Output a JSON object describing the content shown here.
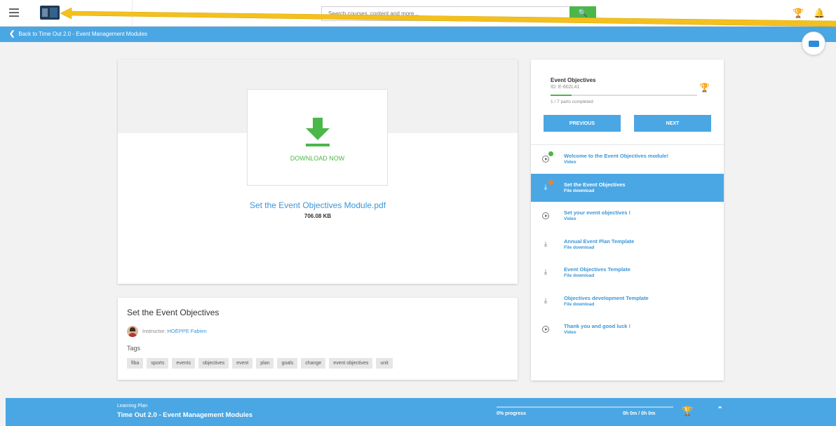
{
  "topbar": {
    "search_placeholder": "Search courses, content and more...",
    "menu_icon": "hamburger-icon",
    "search_icon": "search-icon",
    "trophy_icon": "trophy-icon",
    "bell_icon": "bell-icon"
  },
  "subbar": {
    "back_label": "Back to Time Out 2.0 - Event Management Modules"
  },
  "main": {
    "download_label": "DOWNLOAD NOW",
    "file_name": "Set the Event Objectives Module.pdf",
    "file_size": "706.08 KB"
  },
  "info": {
    "title": "Set the Event Objectives",
    "instructor_prefix": "Instructor:",
    "instructor_name": "HOËPPE Fabien",
    "tags_label": "Tags",
    "tags": [
      "fiba",
      "sports",
      "events",
      "objectives",
      "event",
      "plan",
      "goals",
      "change",
      "event objectives",
      "unit"
    ]
  },
  "sidebar": {
    "title": "Event Objectives",
    "id": "ID: E-602L41",
    "progress_fraction": 0.143,
    "parts_completed": "1 / 7 parts completed",
    "previous_label": "PREVIOUS",
    "next_label": "NEXT",
    "items": [
      {
        "title": "Welcome to the Event Objectives module!",
        "type": "Video",
        "icon": "play-circle-icon",
        "status": "done"
      },
      {
        "title": "Set the Event Objectives",
        "type": "File download",
        "icon": "download-icon",
        "status": "current"
      },
      {
        "title": "Set your event objectives !",
        "type": "Video",
        "icon": "play-circle-icon",
        "status": "none"
      },
      {
        "title": "Annual Event Plan Template",
        "type": "File download",
        "icon": "download-icon",
        "status": "none"
      },
      {
        "title": "Event Objectives Template",
        "type": "File download",
        "icon": "download-icon",
        "status": "none"
      },
      {
        "title": "Objectives development Template",
        "type": "File download",
        "icon": "download-icon",
        "status": "none"
      },
      {
        "title": "Thank you and good luck !",
        "type": "Video",
        "icon": "play-circle-icon",
        "status": "none"
      }
    ]
  },
  "bottombar": {
    "label": "Learning Plan",
    "name": "Time Out 2.0 - Event Management Modules",
    "progress": "0% progress",
    "time": "0h 0m / 0h 0m"
  },
  "colors": {
    "accent_blue": "#4aa7e4",
    "link_blue": "#3a96d8",
    "green": "#4cb749",
    "annotation_arrow": "#f4c01e"
  }
}
